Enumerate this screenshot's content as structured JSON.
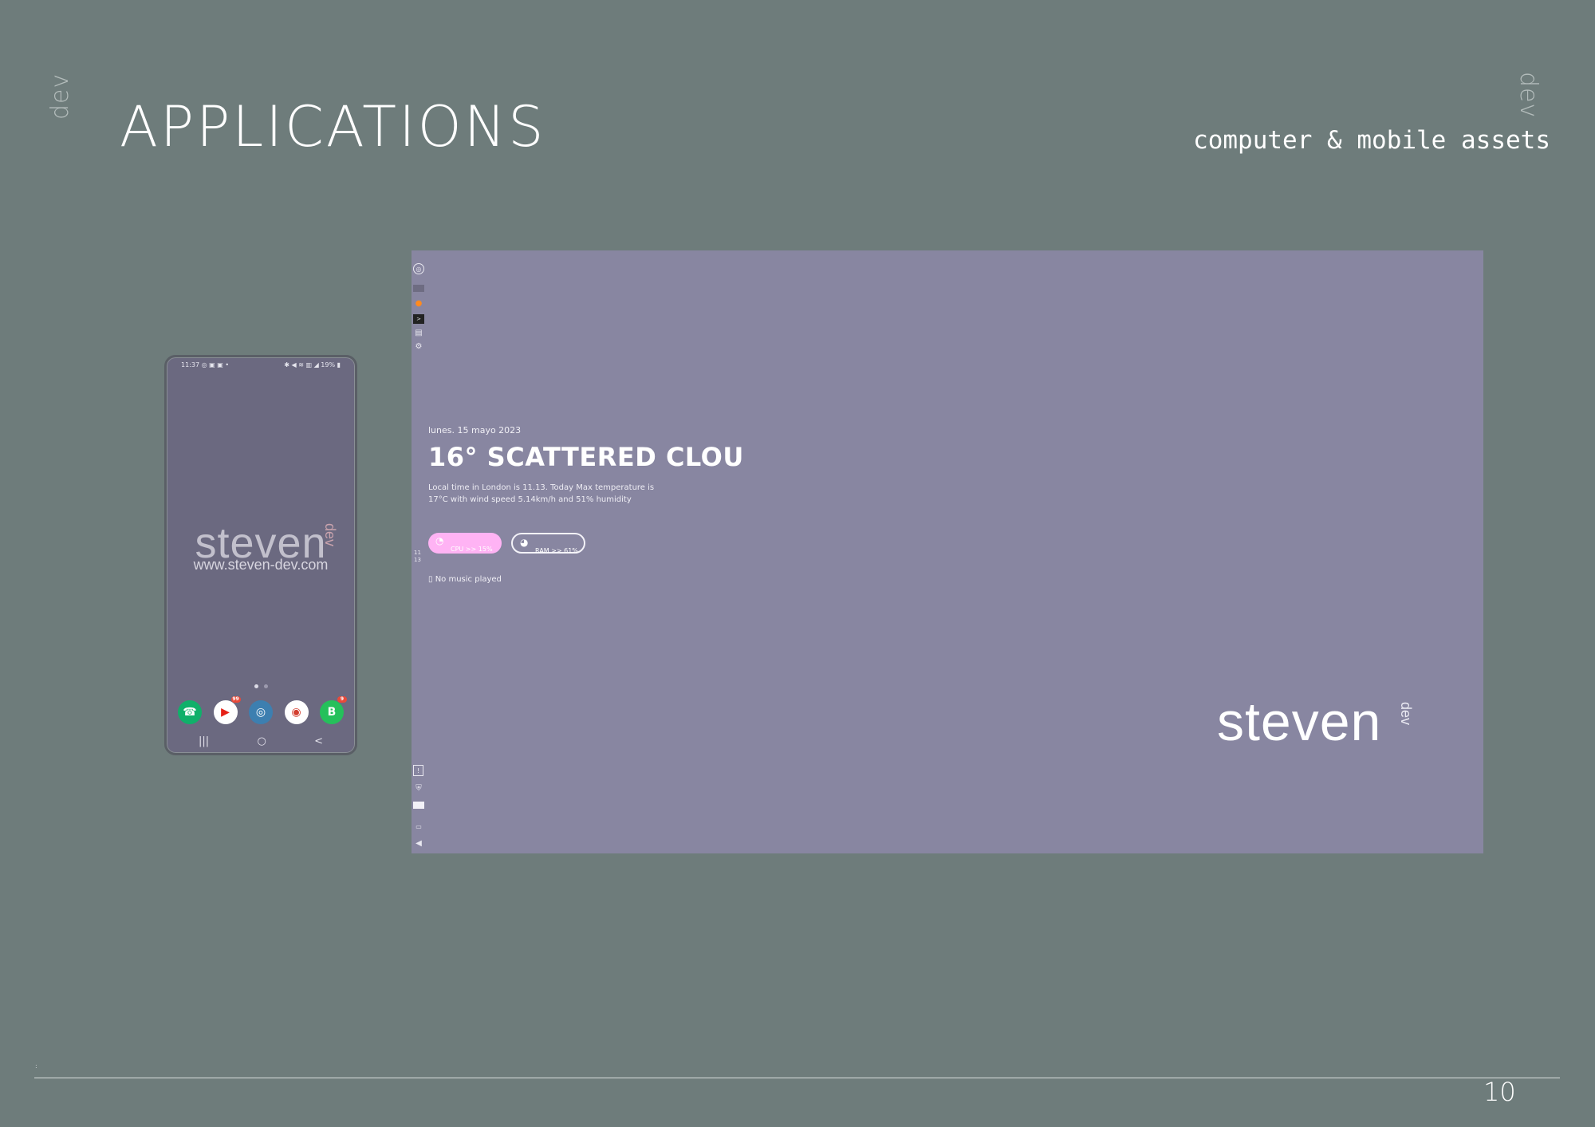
{
  "slide": {
    "side_mark_left": "dev",
    "side_mark_right": "dev",
    "title": "APPLICATIONS",
    "subtitle": "computer & mobile assets",
    "page_number": "10"
  },
  "phone": {
    "status_left": "11:37 ◎ ▣ ▣ •",
    "status_right": "✱ ◀ ≋ ▥ ◢ 19% ▮",
    "logo_word": "steven",
    "logo_dev": "dev",
    "url": "www.steven-dev.com",
    "dock_apps": [
      {
        "name": "phone",
        "glyph": "☎",
        "color": "#10b06a",
        "badge": ""
      },
      {
        "name": "youtube",
        "glyph": "▶",
        "color": "#ffffff",
        "badge": "99"
      },
      {
        "name": "signal",
        "glyph": "◎",
        "color": "#3d7fb0",
        "badge": ""
      },
      {
        "name": "chrome",
        "glyph": "◉",
        "color": "#ffffff",
        "badge": ""
      },
      {
        "name": "whatsapp-business",
        "glyph": "B",
        "color": "#25c05b",
        "badge": "9"
      }
    ],
    "nav": {
      "recents": "|||",
      "home": "○",
      "back": "<"
    }
  },
  "desktop": {
    "date": "lunes. 15 mayo 2023",
    "weather_head": "16° SCATTERED CLOU",
    "weather_line1": "Local time in London  is 11.13. Today Max temperature is",
    "weather_line2": "17°C with wind speed 5.14km/h and 51% humidity",
    "clock_h": "11",
    "clock_m": "13",
    "cpu_label": "CPU >> 15%",
    "ram_label": "RAM >> 61%",
    "music": "No music played",
    "logo_word": "steven",
    "logo_dev": "dev",
    "accent_pill": "#ffb3f4",
    "background": "#8886a1"
  },
  "colors": {
    "slide_background": "#6e7c7b",
    "phone_screen": "#6b6980"
  }
}
